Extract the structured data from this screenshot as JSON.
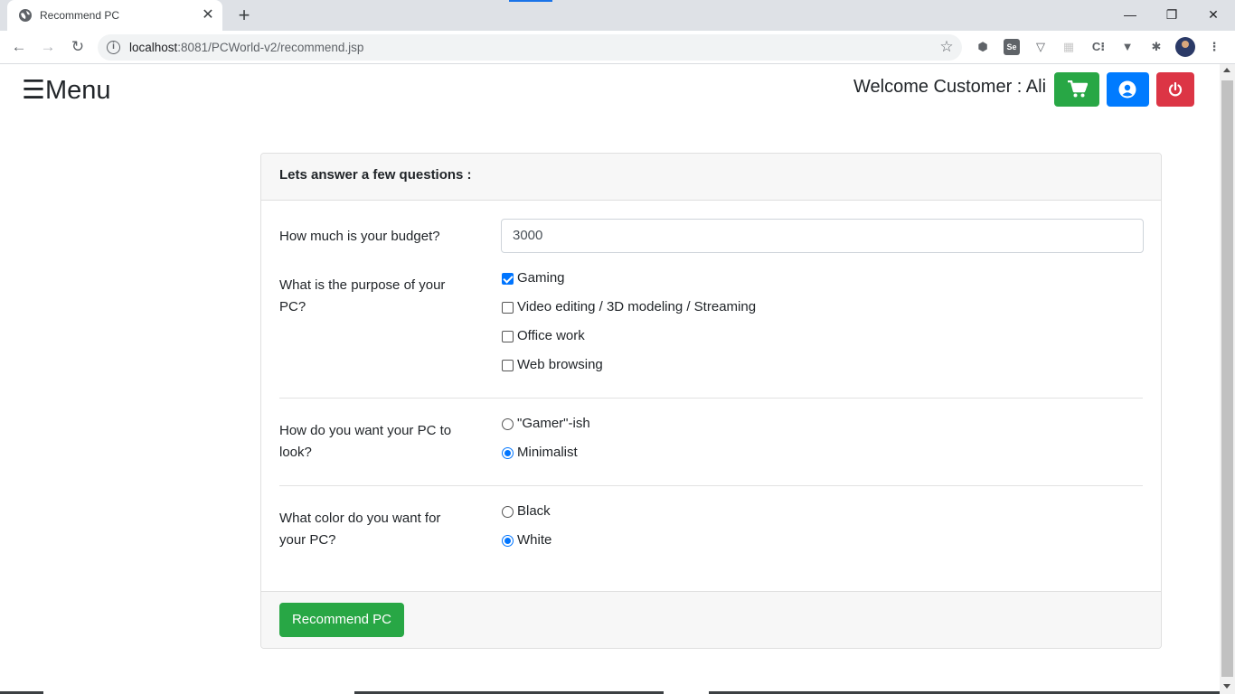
{
  "browser": {
    "tab_title": "Recommend PC",
    "tab_close": "✕",
    "new_tab": "+",
    "url_host": "localhost",
    "url_rest": ":8081/PCWorld-v2/recommend.jsp",
    "window_controls": {
      "minimize": "—",
      "restore": "❐",
      "close": "✕"
    },
    "extensions": [
      "shield-icon",
      "selenium-icon",
      "vpn-icon",
      "grid-icon",
      "code-icon",
      "v-icon",
      "puzzle-icon",
      "profile-avatar"
    ]
  },
  "header": {
    "menu_label": "☰Menu",
    "welcome": "Welcome Customer : Ali",
    "buttons": [
      {
        "name": "cart",
        "color": "#28a745"
      },
      {
        "name": "account",
        "color": "#007bff"
      },
      {
        "name": "logout",
        "color": "#dc3545"
      }
    ]
  },
  "form": {
    "title": "Lets answer a few questions :",
    "budget_label": "How much is your budget?",
    "budget_value": "3000",
    "purpose_label": "What is the purpose of your PC?",
    "purpose_options": [
      {
        "label": "Gaming",
        "checked": true
      },
      {
        "label": "Video editing / 3D modeling / Streaming",
        "checked": false
      },
      {
        "label": "Office work",
        "checked": false
      },
      {
        "label": "Web browsing",
        "checked": false
      }
    ],
    "look_label": "How do you want your PC to look?",
    "look_options": [
      {
        "label": "\"Gamer\"-ish",
        "checked": false
      },
      {
        "label": "Minimalist",
        "checked": true
      }
    ],
    "color_label": "What color do you want for your PC?",
    "color_options": [
      {
        "label": "Black",
        "checked": false
      },
      {
        "label": "White",
        "checked": true
      }
    ],
    "submit_label": "Recommend PC"
  }
}
